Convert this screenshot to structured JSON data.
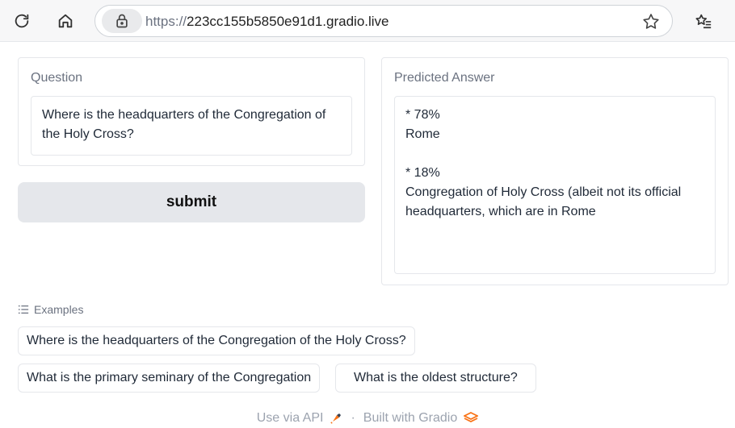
{
  "browser": {
    "url_scheme": "https://",
    "url_host": "223cc155b5850e91d1.gradio.live"
  },
  "question": {
    "label": "Question",
    "value": "Where is the headquarters of the Congregation of the Holy Cross?"
  },
  "submit_label": "submit",
  "answer": {
    "label": "Predicted Answer",
    "value": "* 78%\nRome\n\n* 18%\nCongregation of Holy Cross (albeit not its official headquarters, which are in Rome"
  },
  "examples": {
    "heading": "Examples",
    "items": [
      "Where is the headquarters of the Congregation of the Holy Cross?",
      "What is the primary seminary of the Congregation",
      "What is the oldest structure?"
    ]
  },
  "footer": {
    "api_label": "Use via API",
    "separator": "·",
    "built_label": "Built with Gradio"
  },
  "colors": {
    "accent": "#f97316",
    "button_bg": "#e5e7eb"
  }
}
